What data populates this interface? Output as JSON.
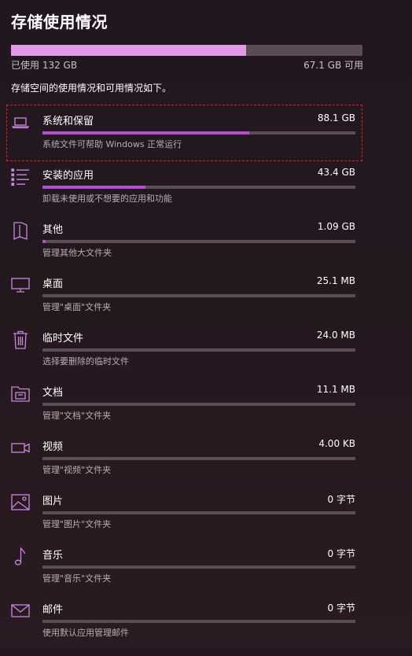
{
  "header": {
    "title": "存储使用情况"
  },
  "summary": {
    "used_label": "已使用 132 GB",
    "free_label": "67.1 GB 可用",
    "used_fraction": 0.67,
    "description": "存储空间的使用情况和可用情况如下。"
  },
  "colors": {
    "accent": "#b24fd2",
    "total_fill": "#e09ae8",
    "track": "#5c4d55",
    "focus_outline": "#e0202a"
  },
  "categories": [
    {
      "key": "system",
      "icon": "laptop-icon",
      "name": "系统和保留",
      "size": "88.1 GB",
      "subtitle": "系统文件可帮助 Windows 正常运行",
      "fraction": 0.66,
      "focused": true
    },
    {
      "key": "apps",
      "icon": "app-list-icon",
      "name": "安装的应用",
      "size": "43.4 GB",
      "subtitle": "卸载未使用或不想要的应用和功能",
      "fraction": 0.33
    },
    {
      "key": "other",
      "icon": "other-doc-icon",
      "name": "其他",
      "size": "1.09 GB",
      "subtitle": "管理其他大文件夹",
      "fraction": 0.01
    },
    {
      "key": "desktop",
      "icon": "monitor-icon",
      "name": "桌面",
      "size": "25.1 MB",
      "subtitle": "管理\"桌面\"文件夹",
      "fraction": 0.0
    },
    {
      "key": "temp",
      "icon": "trash-icon",
      "name": "临时文件",
      "size": "24.0 MB",
      "subtitle": "选择要删除的临时文件",
      "fraction": 0.0
    },
    {
      "key": "documents",
      "icon": "documents-folder-icon",
      "name": "文档",
      "size": "11.1 MB",
      "subtitle": "管理\"文档\"文件夹",
      "fraction": 0.0
    },
    {
      "key": "videos",
      "icon": "video-camera-icon",
      "name": "视频",
      "size": "4.00 KB",
      "subtitle": "管理\"视频\"文件夹",
      "fraction": 0.0
    },
    {
      "key": "pictures",
      "icon": "picture-icon",
      "name": "图片",
      "size": "0 字节",
      "subtitle": "管理\"图片\"文件夹",
      "fraction": 0.0
    },
    {
      "key": "music",
      "icon": "music-note-icon",
      "name": "音乐",
      "size": "0 字节",
      "subtitle": "管理\"音乐\"文件夹",
      "fraction": 0.0
    },
    {
      "key": "mail",
      "icon": "mail-icon",
      "name": "邮件",
      "size": "0 字节",
      "subtitle": "使用默认应用管理邮件",
      "fraction": 0.0
    }
  ]
}
